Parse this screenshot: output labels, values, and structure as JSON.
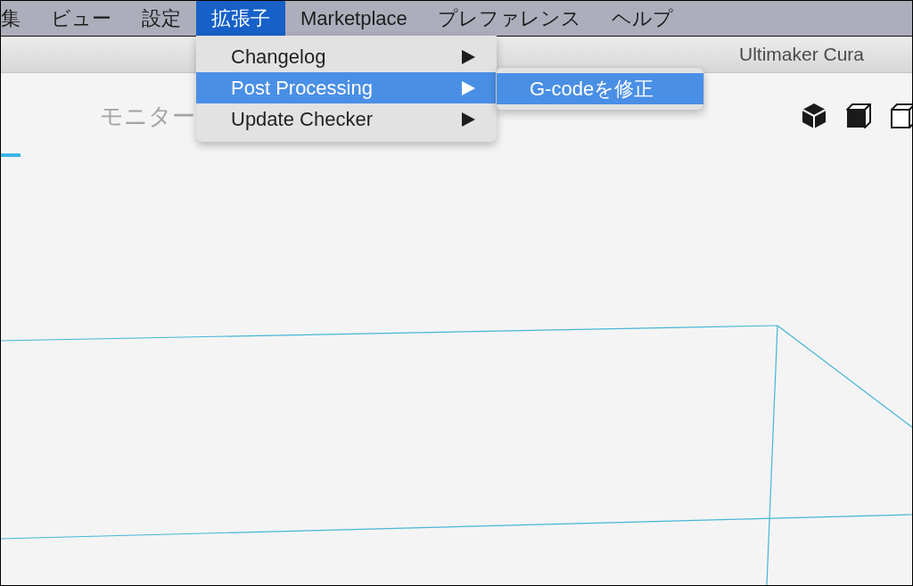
{
  "menu_bar": {
    "items": [
      {
        "label": "集",
        "selected": false
      },
      {
        "label": "ビュー",
        "selected": false
      },
      {
        "label": "設定",
        "selected": false
      },
      {
        "label": "拡張子",
        "selected": true
      },
      {
        "label": "Marketplace",
        "selected": false
      },
      {
        "label": "プレファレンス",
        "selected": false
      },
      {
        "label": "ヘルプ",
        "selected": false
      }
    ]
  },
  "title_bar": {
    "title": "Ultimaker Cura"
  },
  "stage_tab": {
    "label": "モニター",
    "selected": false
  },
  "extensions_menu": {
    "items": [
      {
        "label": "Changelog",
        "submenu": true,
        "selected": false
      },
      {
        "label": "Post Processing",
        "submenu": true,
        "selected": true
      },
      {
        "label": "Update Checker",
        "submenu": true,
        "selected": false
      }
    ]
  },
  "post_processing_submenu": {
    "items": [
      {
        "label": "G-codeを修正",
        "selected": true
      }
    ]
  }
}
